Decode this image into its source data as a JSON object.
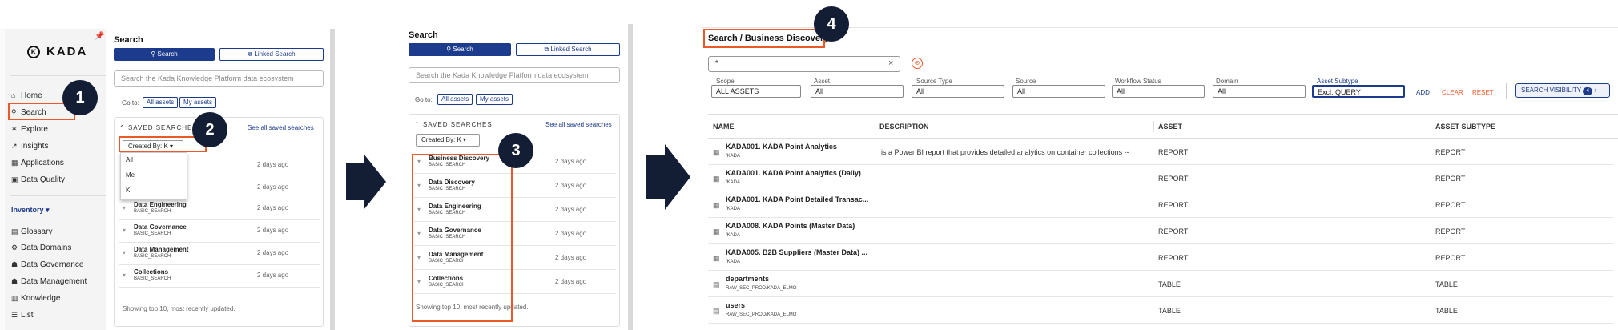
{
  "brand": "KADA",
  "badges": {
    "b1": "1",
    "b2": "2",
    "b3": "3",
    "b4": "4"
  },
  "nav": {
    "home": "Home",
    "search": "Search",
    "explore": "Explore",
    "insights": "Insights",
    "applications": "Applications",
    "data_quality": "Data Quality",
    "inventory": "Inventory",
    "glossary": "Glossary",
    "data_domains": "Data Domains",
    "data_governance": "Data Governance",
    "data_management": "Data Management",
    "knowledge": "Knowledge",
    "list": "List"
  },
  "search": {
    "title": "Search",
    "btn_search": "Search",
    "btn_linked": "Linked Search",
    "placeholder": "Search the Kada Knowledge Platform data ecosystem",
    "goto": "Go to:",
    "all_assets": "All assets",
    "my_assets": "My assets"
  },
  "saved": {
    "header": "SAVED SEARCHES",
    "header_short": "SAVED SEARCHE",
    "see_all": "See all saved searches",
    "created_by": "Created By: K",
    "footer": "Showing top 10, most recently updated.",
    "dropdown": [
      "All",
      "Me",
      "K"
    ],
    "items": [
      {
        "name": "Business Discovery",
        "sub": "BASIC_SEARCH",
        "date": "2 days ago"
      },
      {
        "name": "Data Discovery",
        "sub": "BASIC_SEARCH",
        "date": "2 days ago"
      },
      {
        "name": "Data Engineering",
        "sub": "BASIC_SEARCH",
        "date": "2 days ago"
      },
      {
        "name": "Data Governance",
        "sub": "BASIC_SEARCH",
        "date": "2 days ago"
      },
      {
        "name": "Data Management",
        "sub": "BASIC_SEARCH",
        "date": "2 days ago"
      },
      {
        "name": "Collections",
        "sub": "BASIC_SEARCH",
        "date": "2 days ago"
      }
    ]
  },
  "discovery": {
    "title": "Search / Business Discovery",
    "query": "*",
    "filters": [
      {
        "label": "Scope",
        "value": "ALL ASSETS"
      },
      {
        "label": "Asset",
        "value": "All"
      },
      {
        "label": "Source Type",
        "value": "All"
      },
      {
        "label": "Source",
        "value": "All"
      },
      {
        "label": "Workflow Status",
        "value": "All"
      },
      {
        "label": "Domain",
        "value": "All"
      },
      {
        "label": "Asset Subtype",
        "value": "Excl: QUERY"
      }
    ],
    "add": "ADD",
    "clear": "CLEAR",
    "reset": "RESET",
    "visibility": "SEARCH VISIBILITY",
    "visibility_count": "4",
    "columns": [
      "NAME",
      "DESCRIPTION",
      "ASSET",
      "ASSET SUBTYPE"
    ],
    "rows": [
      {
        "name": "KADA001. KADA Point Analytics",
        "path": "/KADA",
        "desc": "is a Power BI report that provides detailed analytics on container collections --",
        "asset": "REPORT",
        "subtype": "REPORT"
      },
      {
        "name": "KADA001. KADA Point Analytics (Daily)",
        "path": "/KADA",
        "desc": "",
        "asset": "REPORT",
        "subtype": "REPORT"
      },
      {
        "name": "KADA001. KADA Point Detailed Transac...",
        "path": "/KADA",
        "desc": "",
        "asset": "REPORT",
        "subtype": "REPORT"
      },
      {
        "name": "KADA008. KADA Points (Master Data)",
        "path": "/KADA",
        "desc": "",
        "asset": "REPORT",
        "subtype": "REPORT"
      },
      {
        "name": "KADA005. B2B Suppliers (Master Data) ...",
        "path": "/KADA",
        "desc": "",
        "asset": "REPORT",
        "subtype": "REPORT"
      },
      {
        "name": "departments",
        "path": "RAW_SEC_PROD/KADA_ELMO",
        "desc": "",
        "asset": "TABLE",
        "subtype": "TABLE"
      },
      {
        "name": "users",
        "path": "RAW_SEC_PROD/KADA_ELMO",
        "desc": "",
        "asset": "TABLE",
        "subtype": "TABLE"
      }
    ]
  }
}
